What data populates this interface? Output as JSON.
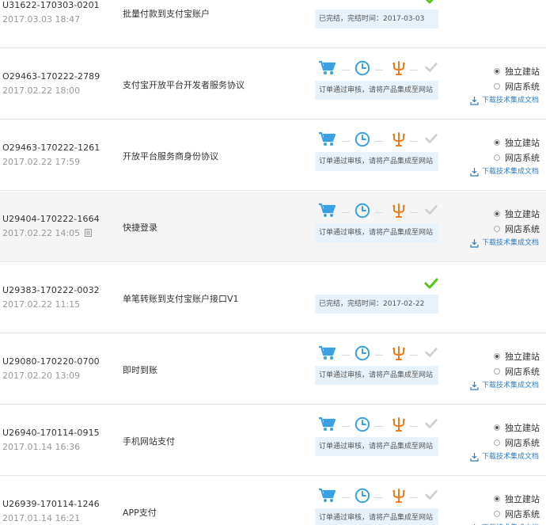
{
  "common": {
    "pending_note": "订单通过审核，请将产品集成至网站",
    "opt_standalone": "独立建站",
    "opt_shop": "网店系统",
    "download_doc": "下载技术集成文档"
  },
  "rows": [
    {
      "order_id": "U31622-170303-0201",
      "time": "2017.03.03 18:47",
      "product": "批量付款到支付宝账户",
      "status": "done",
      "done_note": "已完结，完结时间：2017-03-03"
    },
    {
      "order_id": "O29463-170222-2789",
      "time": "2017.02.22 18:00",
      "product": "支付宝开放平台开发者服务协议",
      "status": "pending"
    },
    {
      "order_id": "O29463-170222-1261",
      "time": "2017.02.22 17:59",
      "product": "开放平台服务商身份协议",
      "status": "pending"
    },
    {
      "order_id": "U29404-170222-1664",
      "time": "2017.02.22 14:05",
      "product": "快捷登录",
      "status": "pending",
      "highlight": true
    },
    {
      "order_id": "U29383-170222-0032",
      "time": "2017.02.22 11:15",
      "product": "单笔转账到支付宝账户接口V1",
      "status": "done",
      "done_note": "已完结，完结时间：2017-02-22"
    },
    {
      "order_id": "U29080-170220-0700",
      "time": "2017.02.20 13:09",
      "product": "即时到账",
      "status": "pending"
    },
    {
      "order_id": "U26940-170114-0915",
      "time": "2017.01.14 16:36",
      "product": "手机网站支付",
      "status": "pending"
    },
    {
      "order_id": "U26939-170114-1246",
      "time": "2017.01.14 16:21",
      "product": "APP支付",
      "status": "pending"
    }
  ],
  "colors": {
    "accent_blue": "#3aa0e6",
    "accent_orange": "#f07a1c",
    "done_green": "#5cc01a",
    "pending_gray": "#cfcfcf"
  }
}
